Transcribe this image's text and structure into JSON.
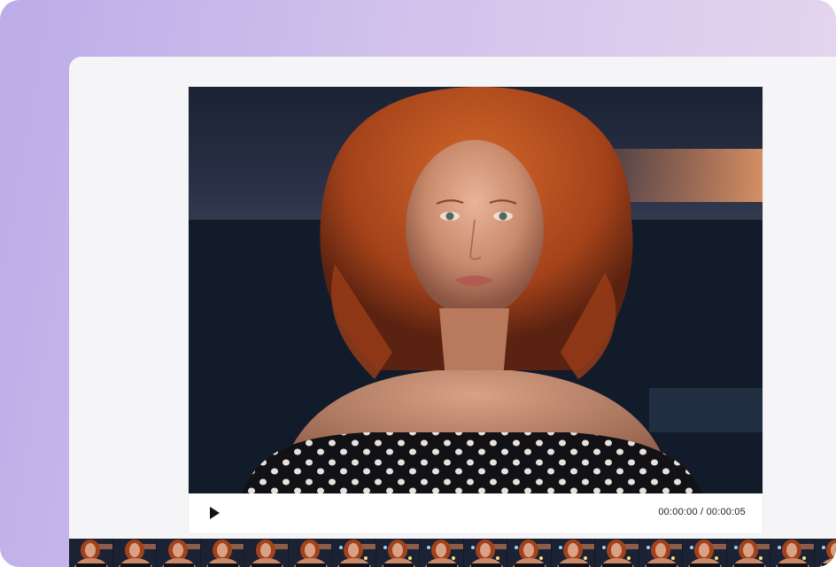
{
  "player": {
    "current_time": "00:00:00",
    "separator": "/",
    "duration": "00:00:05"
  },
  "icons": {
    "play": "play-icon"
  },
  "filmstrip": {
    "frame_count": 18
  },
  "colors": {
    "background_gradient_start": "#bcace8",
    "background_gradient_end": "#e9d8ee",
    "panel": "#f5f5f8",
    "controls_bar": "#ffffff"
  }
}
